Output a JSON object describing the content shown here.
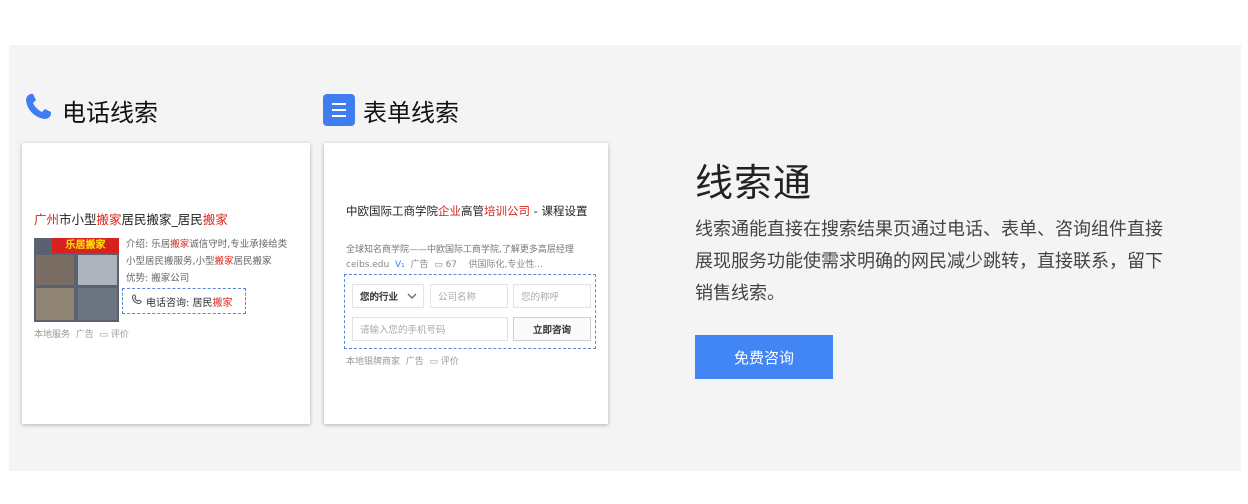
{
  "phone_section": {
    "icon": "phone-icon",
    "heading": "电话线索",
    "card": {
      "title_parts": [
        "广州",
        "市小型",
        "搬家",
        "居民搬家_居民",
        "搬家"
      ],
      "thumb_banner": "乐居搬家",
      "desc_line1_parts": [
        "介绍: 乐居",
        "搬家",
        "诚信守时,专业承接"
      ],
      "desc_line1_tail": "给类",
      "desc_line2_parts": [
        "小型居民搬服务,小型",
        "搬家",
        "居民搬家"
      ],
      "desc_line3": "优势: 搬家公司",
      "call_label_parts": [
        "电话咨询: 居民",
        "搬家"
      ],
      "meta": [
        "本地服务",
        "广告",
        "评价"
      ]
    }
  },
  "form_section": {
    "icon": "form-list-icon",
    "heading": "表单线索",
    "card": {
      "title_parts": [
        "中欧国际工商学院",
        "企业",
        "高管",
        "培训公司",
        " - 课程设置"
      ],
      "sub": "全球知名商学院——中欧国际工商学院,了解更多高层经理",
      "sub2_parts": [
        "ceibs.edu",
        "V₁",
        "广告",
        "67",
        "供国际化,专业性..."
      ],
      "industry_select": "您的行业",
      "company_placeholder": "公司名称",
      "name_placeholder": "您的称呼",
      "phone_placeholder": "请输入您的手机号码",
      "submit_label": "立即咨询",
      "meta": [
        "本地银牌商家",
        "广告",
        "评价"
      ]
    }
  },
  "product": {
    "title": "线索通",
    "description": "线索通能直接在搜索结果页通过电话、表单、咨询组件直接展现服务功能使需求明确的网民减少跳转，直接联系，留下销售线索。",
    "cta_label": "免费咨询"
  },
  "colors": {
    "accent": "#4285f4",
    "highlight_red": "#d9261c",
    "panel_bg": "#f4f4f4"
  }
}
